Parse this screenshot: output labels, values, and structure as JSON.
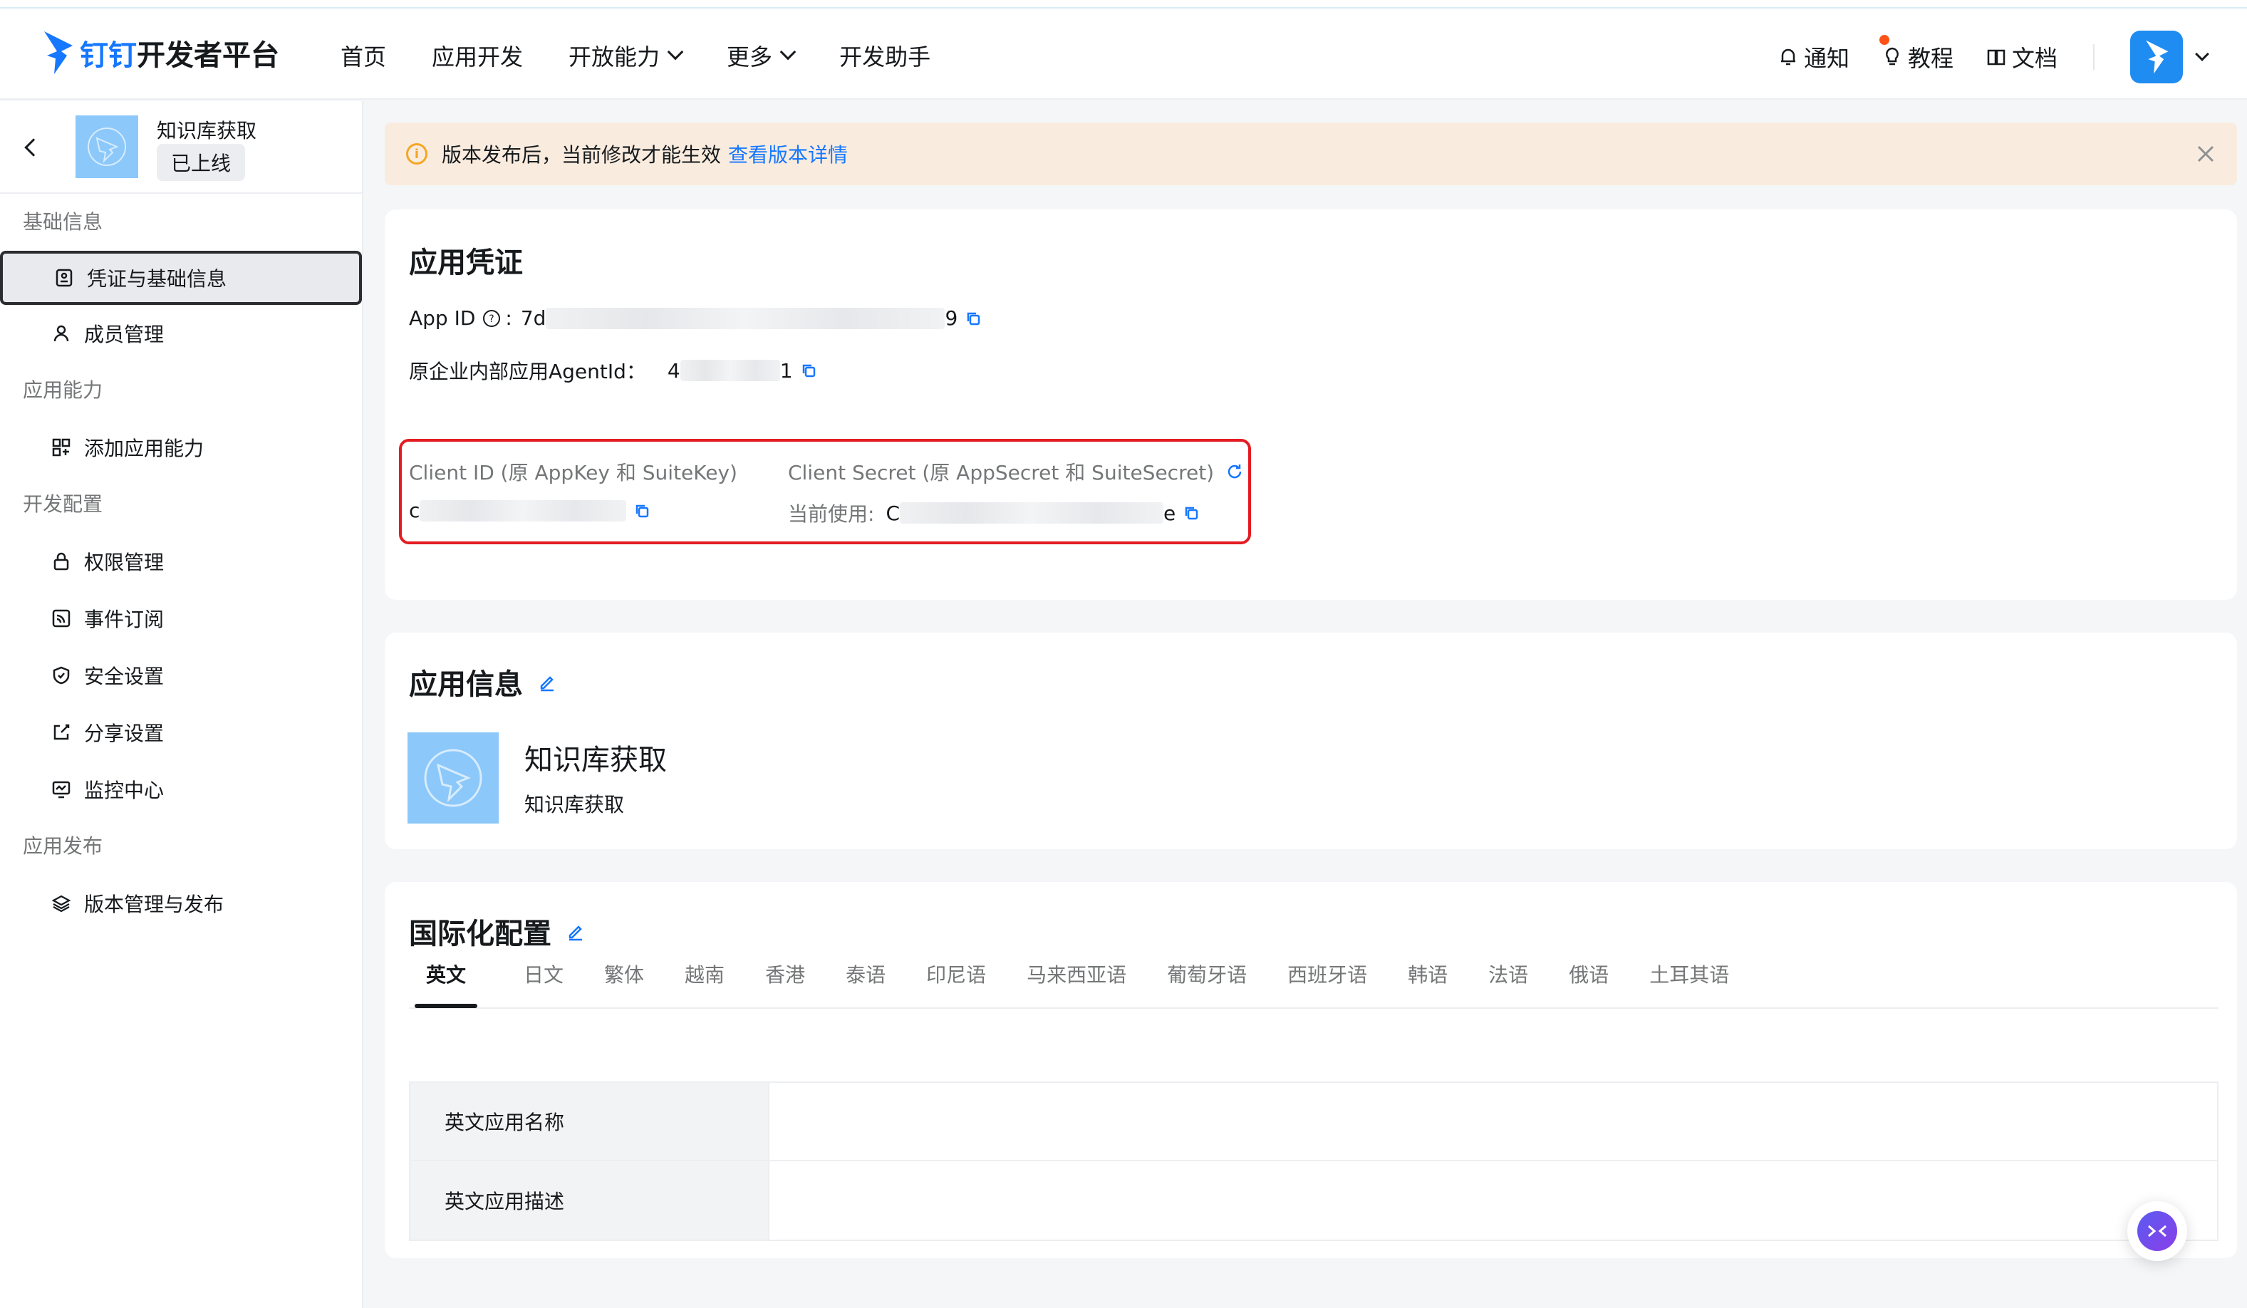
{
  "header": {
    "logo_brand": "钉钉",
    "logo_suffix": "开发者平台",
    "nav": [
      {
        "label": "首页"
      },
      {
        "label": "应用开发"
      },
      {
        "label": "开放能力",
        "dropdown": true
      },
      {
        "label": "更多",
        "dropdown": true
      },
      {
        "label": "开发助手"
      }
    ],
    "notify_label": "通知",
    "tutorial_label": "教程",
    "docs_label": "文档"
  },
  "sidebar": {
    "app_name": "知识库获取",
    "app_status": "已上线",
    "sections": [
      {
        "title": "基础信息",
        "items": [
          {
            "label": "凭证与基础信息",
            "icon": "credential-icon",
            "active": true
          },
          {
            "label": "成员管理",
            "icon": "user-icon"
          }
        ]
      },
      {
        "title": "应用能力",
        "items": [
          {
            "label": "添加应用能力",
            "icon": "apps-grid-icon"
          }
        ]
      },
      {
        "title": "开发配置",
        "items": [
          {
            "label": "权限管理",
            "icon": "lock-icon"
          },
          {
            "label": "事件订阅",
            "icon": "rss-icon"
          },
          {
            "label": "安全设置",
            "icon": "shield-icon"
          },
          {
            "label": "分享设置",
            "icon": "share-icon"
          },
          {
            "label": "监控中心",
            "icon": "monitor-icon"
          }
        ]
      },
      {
        "title": "应用发布",
        "items": [
          {
            "label": "版本管理与发布",
            "icon": "layers-icon"
          }
        ]
      }
    ]
  },
  "banner": {
    "text": "版本发布后，当前修改才能生效",
    "link": "查看版本详情"
  },
  "credentials": {
    "title": "应用凭证",
    "app_id_label": "App ID",
    "app_id_prefix": "7d",
    "app_id_suffix": "9",
    "agent_id_label": "原企业内部应用AgentId：",
    "agent_id_prefix": "4",
    "agent_id_suffix": "1",
    "client_id_label": "Client ID (原 AppKey 和 SuiteKey)",
    "client_id_prefix": "c",
    "client_secret_label": "Client Secret (原 AppSecret 和 SuiteSecret)",
    "current_use_label": "当前使用:",
    "client_secret_prefix": "C",
    "client_secret_suffix": "e"
  },
  "app_info": {
    "title": "应用信息",
    "name": "知识库获取",
    "desc": "知识库获取"
  },
  "i18n": {
    "title": "国际化配置",
    "tabs": [
      "英文",
      "日文",
      "繁体",
      "越南",
      "香港",
      "泰语",
      "印尼语",
      "马来西亚语",
      "葡萄牙语",
      "西班牙语",
      "韩语",
      "法语",
      "俄语",
      "土耳其语"
    ],
    "active_tab": "英文",
    "rows": [
      {
        "label": "英文应用名称",
        "value": ""
      },
      {
        "label": "英文应用描述",
        "value": ""
      }
    ]
  },
  "colors": {
    "accent": "#1677ff",
    "highlight_box": "#e31c22",
    "banner_bg": "#f9ecdf"
  }
}
